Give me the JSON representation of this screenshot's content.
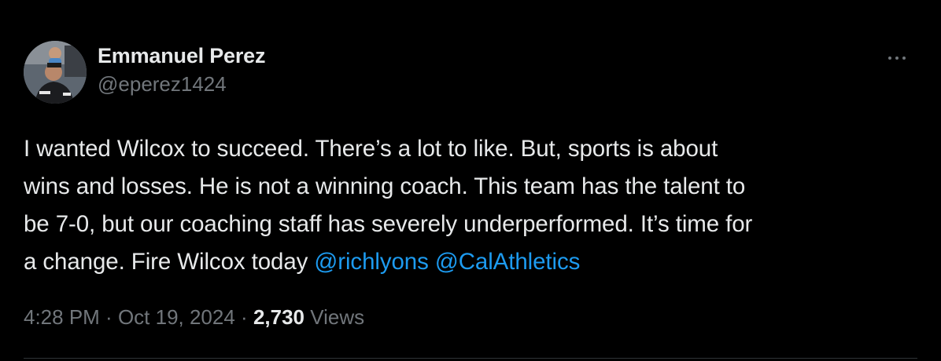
{
  "author": {
    "display_name": "Emmanuel Perez",
    "handle": "@eperez1424"
  },
  "tweet": {
    "lines": [
      "I wanted Wilcox to succeed. There’s a lot to like. But, sports is about",
      "wins and losses. He is not a winning coach. This team has the talent to",
      "be 7-0, but our coaching staff has severely underperformed. It’s time for"
    ],
    "last_line_text": "a change. Fire Wilcox today ",
    "mentions": [
      "@richlyons",
      "@CalAthletics"
    ]
  },
  "meta": {
    "time": "4:28 PM",
    "separator": " · ",
    "date": "Oct 19, 2024",
    "views_count": "2,730",
    "views_label": "Views"
  },
  "colors": {
    "background": "#000000",
    "text": "#e7e9ea",
    "secondary": "#71767b",
    "link": "#1d9bf0",
    "divider": "#2f3336"
  },
  "icons": {
    "more": "more-horizontal-icon",
    "avatar": "profile-photo"
  }
}
